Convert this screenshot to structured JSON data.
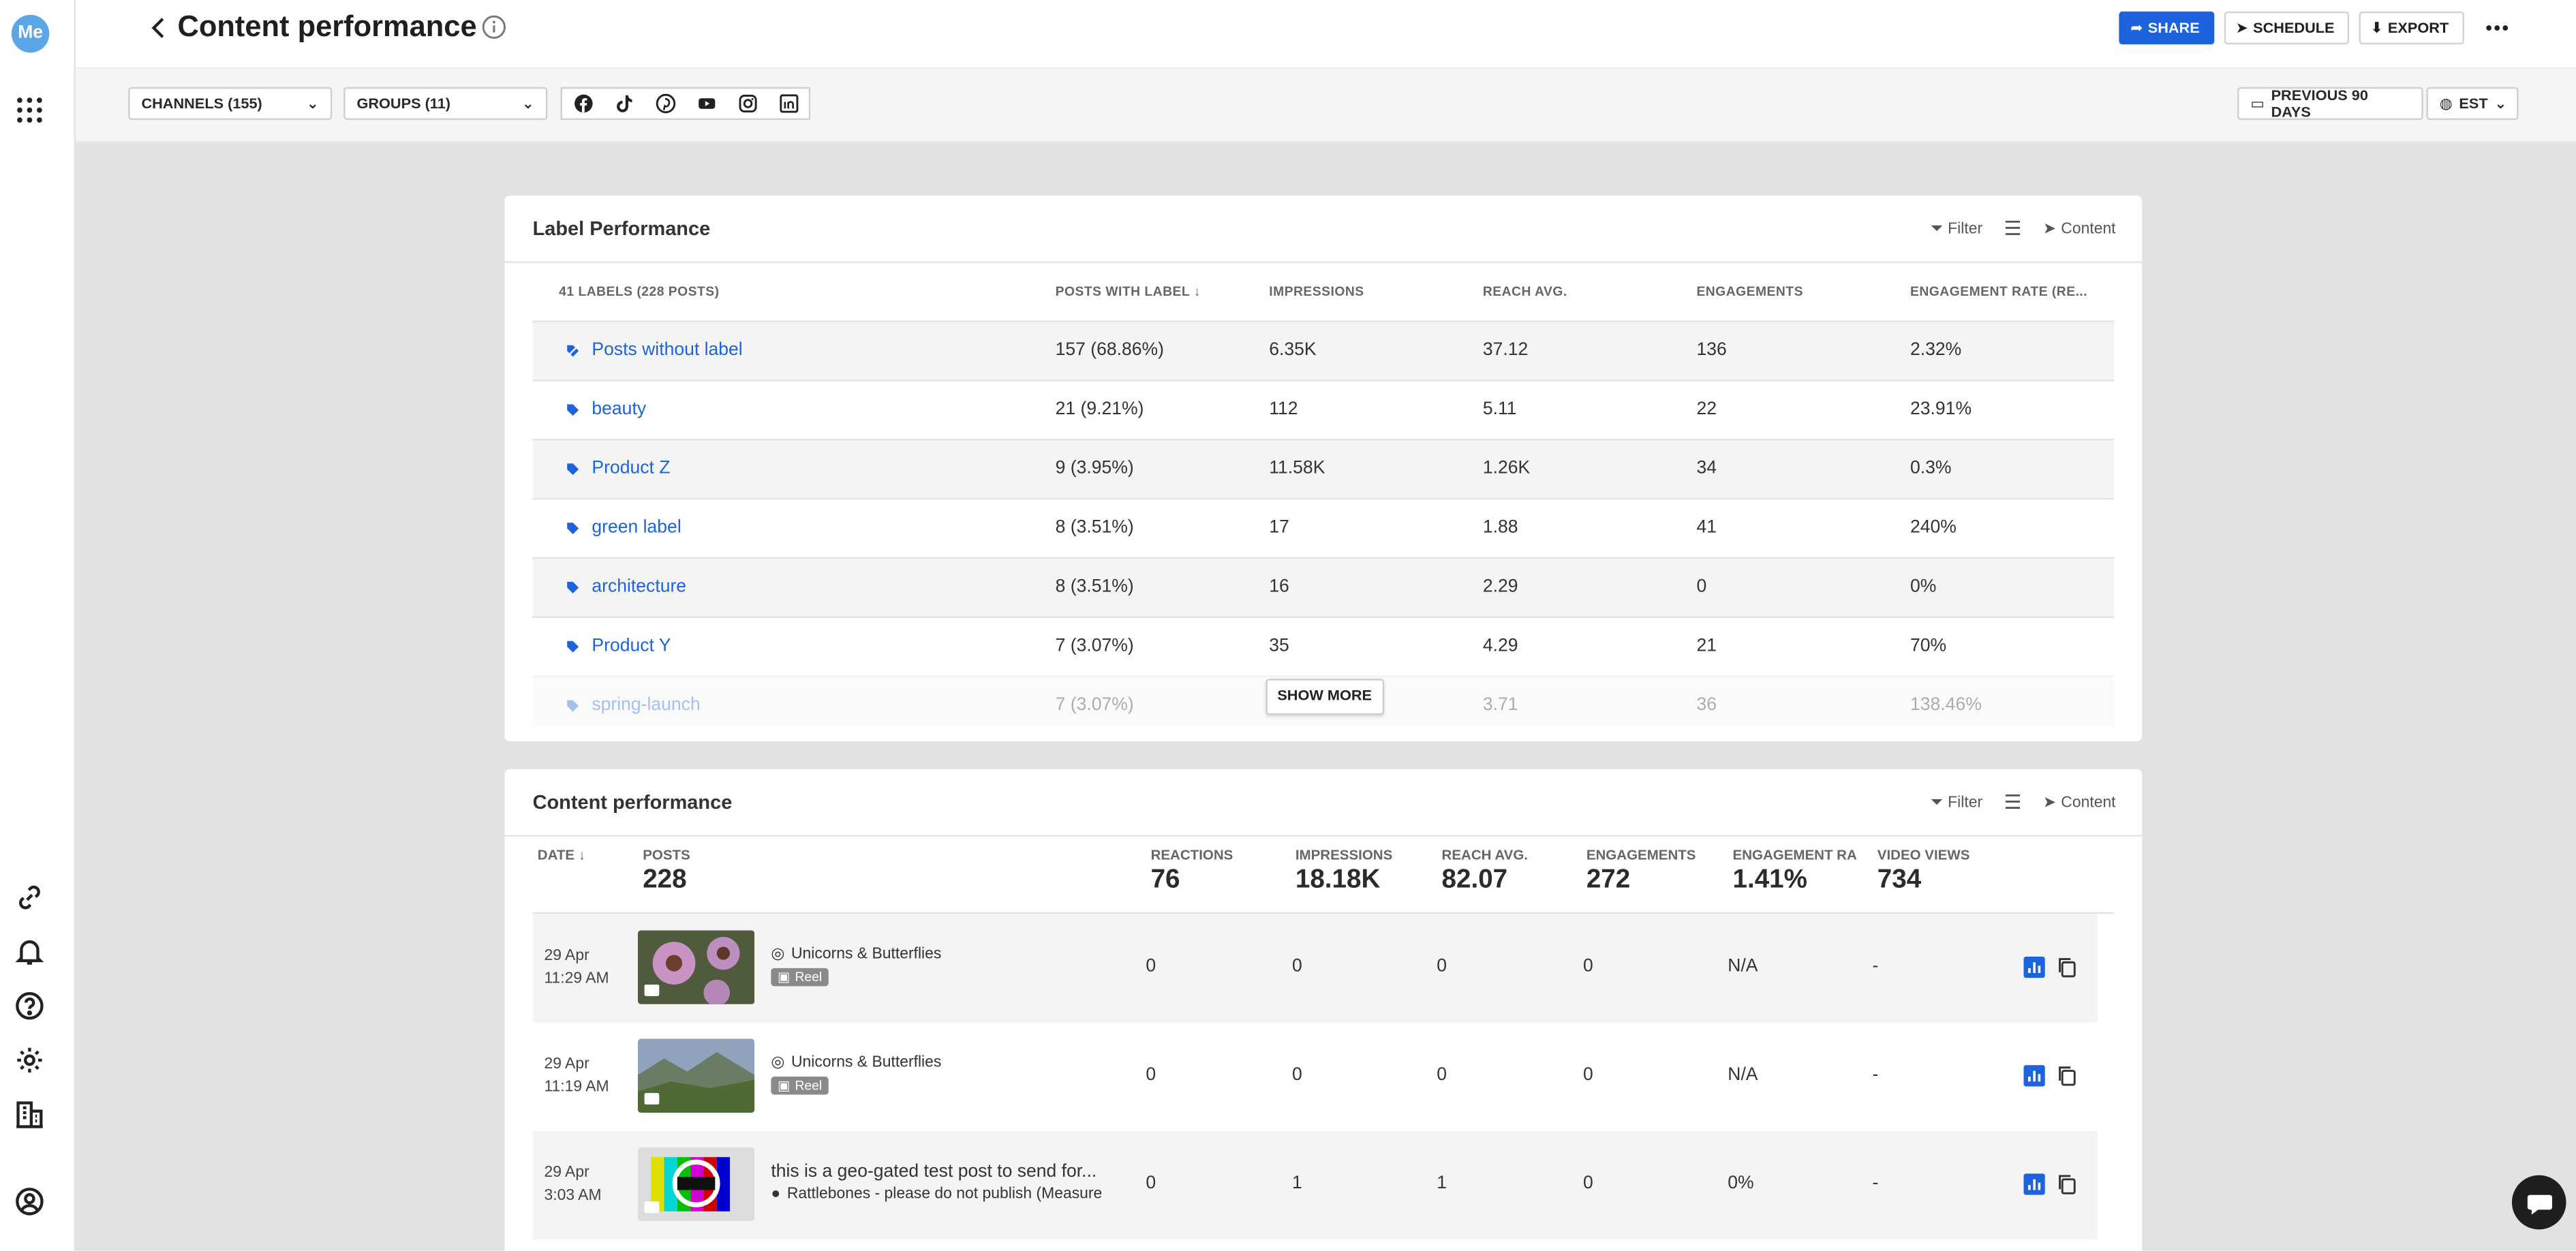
{
  "app": {
    "logo_text": "Me"
  },
  "header": {
    "title": "Content performance",
    "share": "SHARE",
    "schedule": "SCHEDULE",
    "export": "EXPORT"
  },
  "filters": {
    "channels": "CHANNELS (155)",
    "groups": "GROUPS (11)",
    "networks": [
      "facebook-icon",
      "tiktok-icon",
      "pinterest-icon",
      "youtube-icon",
      "instagram-icon",
      "linkedin-icon"
    ],
    "date_range": "PREVIOUS 90 DAYS",
    "timezone": "EST"
  },
  "label_card": {
    "title": "Label Performance",
    "filter": "Filter",
    "content": "Content",
    "columns": [
      "41 LABELS (228 POSTS)",
      "POSTS WITH LABEL",
      "IMPRESSIONS",
      "REACH AVG.",
      "ENGAGEMENTS",
      "ENGAGEMENT RATE (RE..."
    ],
    "rows": [
      {
        "label": "Posts without label",
        "posts": "157 (68.86%)",
        "impressions": "6.35K",
        "reach": "37.12",
        "engagements": "136",
        "rate": "2.32%"
      },
      {
        "label": "beauty",
        "posts": "21 (9.21%)",
        "impressions": "112",
        "reach": "5.11",
        "engagements": "22",
        "rate": "23.91%"
      },
      {
        "label": "Product Z",
        "posts": "9 (3.95%)",
        "impressions": "11.58K",
        "reach": "1.26K",
        "engagements": "34",
        "rate": "0.3%"
      },
      {
        "label": "green label",
        "posts": "8 (3.51%)",
        "impressions": "17",
        "reach": "1.88",
        "engagements": "41",
        "rate": "240%"
      },
      {
        "label": "architecture",
        "posts": "8 (3.51%)",
        "impressions": "16",
        "reach": "2.29",
        "engagements": "0",
        "rate": "0%"
      },
      {
        "label": "Product Y",
        "posts": "7 (3.07%)",
        "impressions": "35",
        "reach": "4.29",
        "engagements": "21",
        "rate": "70%"
      },
      {
        "label": "spring-launch",
        "posts": "7 (3.07%)",
        "impressions": "",
        "reach": "3.71",
        "engagements": "36",
        "rate": "138.46%"
      }
    ],
    "show_more": "SHOW MORE"
  },
  "content_card": {
    "title": "Content performance",
    "filter": "Filter",
    "content": "Content",
    "summary": {
      "date": "DATE",
      "posts_label": "POSTS",
      "posts": "228",
      "reactions_label": "REACTIONS",
      "reactions": "76",
      "impressions_label": "IMPRESSIONS",
      "impressions": "18.18K",
      "reach_label": "REACH AVG.",
      "reach": "82.07",
      "engagements_label": "ENGAGEMENTS",
      "engagements": "272",
      "rate_label": "ENGAGEMENT RA",
      "rate": "1.41%",
      "views_label": "VIDEO VIEWS",
      "views": "734"
    },
    "rows": [
      {
        "date": "29 Apr",
        "time": "11:29 AM",
        "channel": "Unicorns & Butterflies",
        "badge": "Reel",
        "reactions": "0",
        "impressions": "0",
        "reach": "0",
        "engagements": "0",
        "rate": "N/A",
        "views": "-"
      },
      {
        "date": "29 Apr",
        "time": "11:19 AM",
        "channel": "Unicorns & Butterflies",
        "badge": "Reel",
        "reactions": "0",
        "impressions": "0",
        "reach": "0",
        "engagements": "0",
        "rate": "N/A",
        "views": "-"
      },
      {
        "date": "29 Apr",
        "time": "3:03 AM",
        "text": "this is a geo-gated test post to send for...",
        "channel": "Rattlebones - please do not publish (Measure",
        "reactions": "0",
        "impressions": "1",
        "reach": "1",
        "engagements": "0",
        "rate": "0%",
        "views": "-"
      }
    ]
  }
}
